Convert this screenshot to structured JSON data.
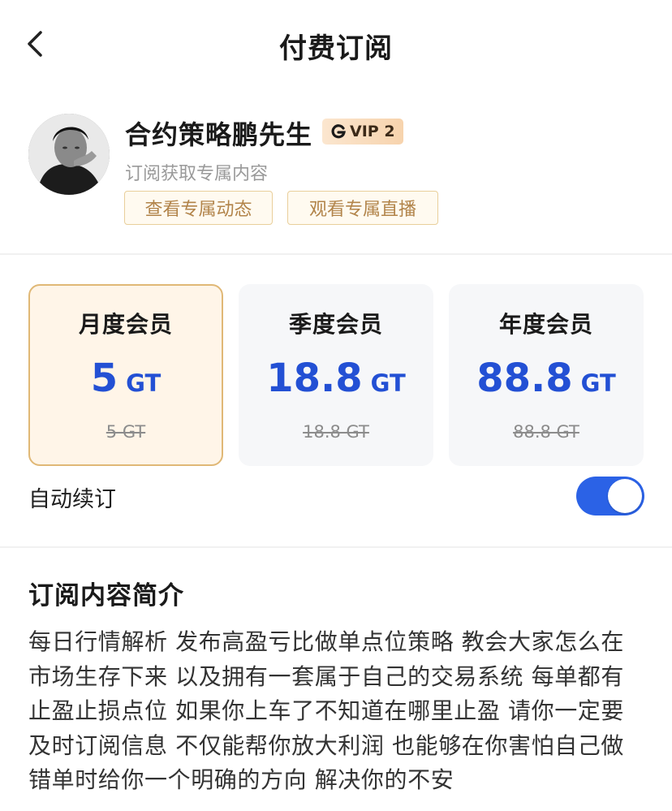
{
  "header": {
    "title": "付费订阅",
    "back_icon": "chevron-left-icon"
  },
  "profile": {
    "name": "合约策略鹏先生",
    "vip_badge": "VIP 2",
    "vip_icon": "g-logo-icon",
    "subtitle": "订阅获取专属内容",
    "buttons": [
      "查看专属动态",
      "观看专属直播"
    ]
  },
  "plans": [
    {
      "name": "月度会员",
      "price": "5",
      "unit": "GT",
      "original": "5 GT",
      "selected": true
    },
    {
      "name": "季度会员",
      "price": "18.8",
      "unit": "GT",
      "original": "18.8 GT",
      "selected": false
    },
    {
      "name": "年度会员",
      "price": "88.8",
      "unit": "GT",
      "original": "88.8 GT",
      "selected": false
    }
  ],
  "auto_renew": {
    "label": "自动续订",
    "enabled": true
  },
  "intro": {
    "title": "订阅内容简介",
    "text": "每日行情解析 发布高盈亏比做单点位策略 教会大家怎么在市场生存下来 以及拥有一套属于自己的交易系统 每单都有止盈止损点位 如果你上车了不知道在哪里止盈 请你一定要及时订阅信息 不仅能帮你放大利润 也能够在你害怕自己做错单时给你一个明确的方向 解决你的不安"
  },
  "colors": {
    "accent": "#2b62e6",
    "price": "#2350d4",
    "gold_border": "#e0b876"
  }
}
